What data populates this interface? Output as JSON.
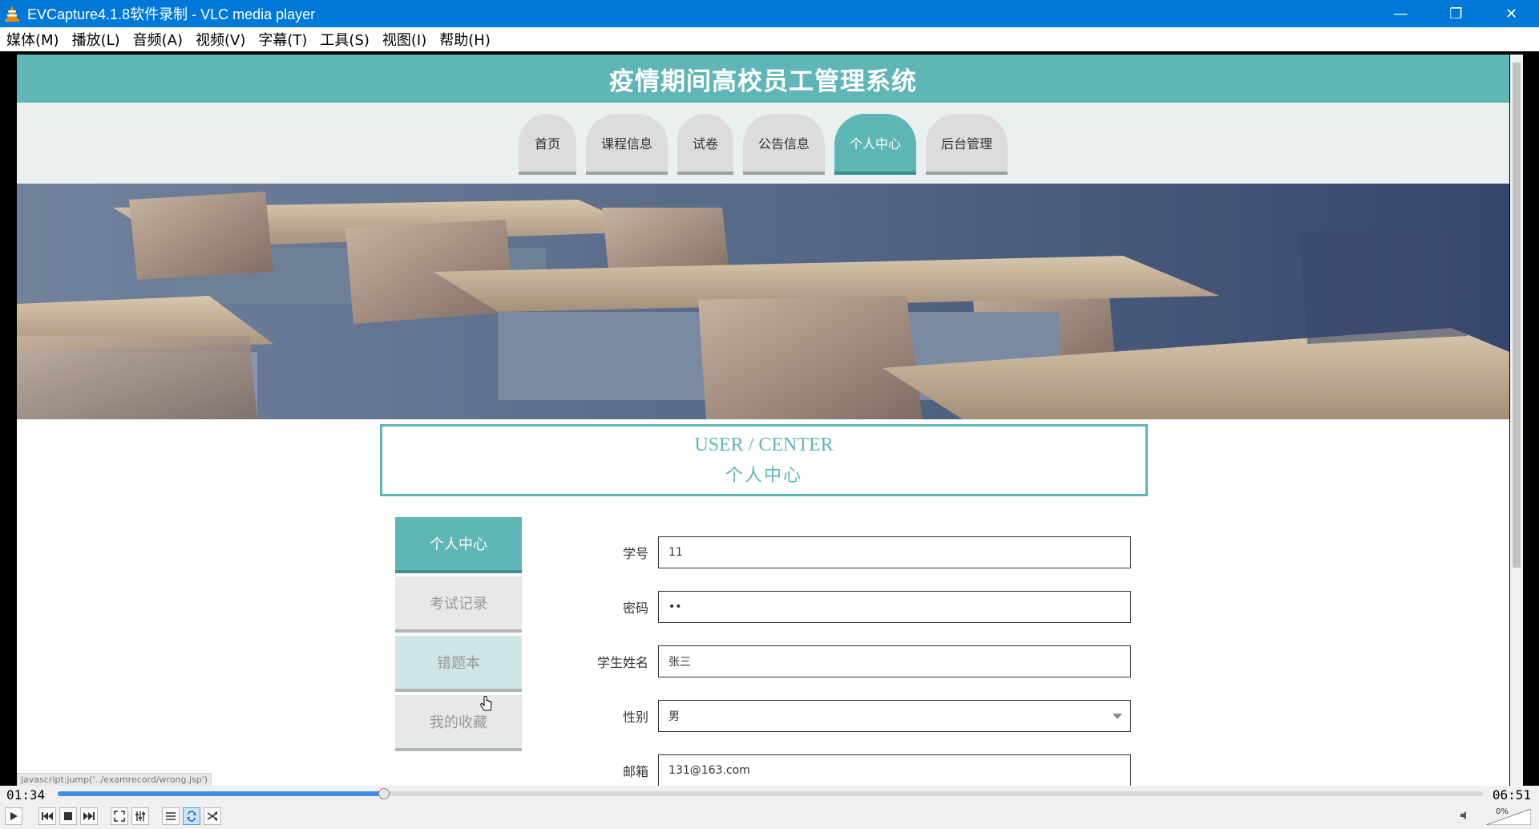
{
  "window": {
    "title": "EVCapture4.1.8软件录制 - VLC media player",
    "minimize": "—",
    "restore": "❐",
    "close": "✕"
  },
  "menu": [
    "媒体(M)",
    "播放(L)",
    "音频(A)",
    "视频(V)",
    "字幕(T)",
    "工具(S)",
    "视图(I)",
    "帮助(H)"
  ],
  "site": {
    "title": "疫情期间高校员工管理系统",
    "nav": [
      "首页",
      "课程信息",
      "试卷",
      "公告信息",
      "个人中心",
      "后台管理"
    ],
    "active_nav": "个人中心"
  },
  "center": {
    "en": "USER / CENTER",
    "cn": "个人中心"
  },
  "sidebar": [
    "个人中心",
    "考试记录",
    "错题本",
    "我的收藏"
  ],
  "form": {
    "fields": [
      {
        "label": "学号",
        "value": "11"
      },
      {
        "label": "密码",
        "value": "••"
      },
      {
        "label": "学生姓名",
        "value": "张三"
      },
      {
        "label": "性别",
        "value": "男"
      },
      {
        "label": "邮箱",
        "value": "131@163.com"
      }
    ]
  },
  "status_link": "javascript:jump('../examrecord/wrong.jsp')",
  "player": {
    "elapsed": "01:34",
    "total": "06:51",
    "progress": 0.229,
    "volume_label": "0%"
  },
  "colors": {
    "accent": "#5fb6b6",
    "titlebar": "#0078d7",
    "seek_fill": "#3d8ee6"
  }
}
